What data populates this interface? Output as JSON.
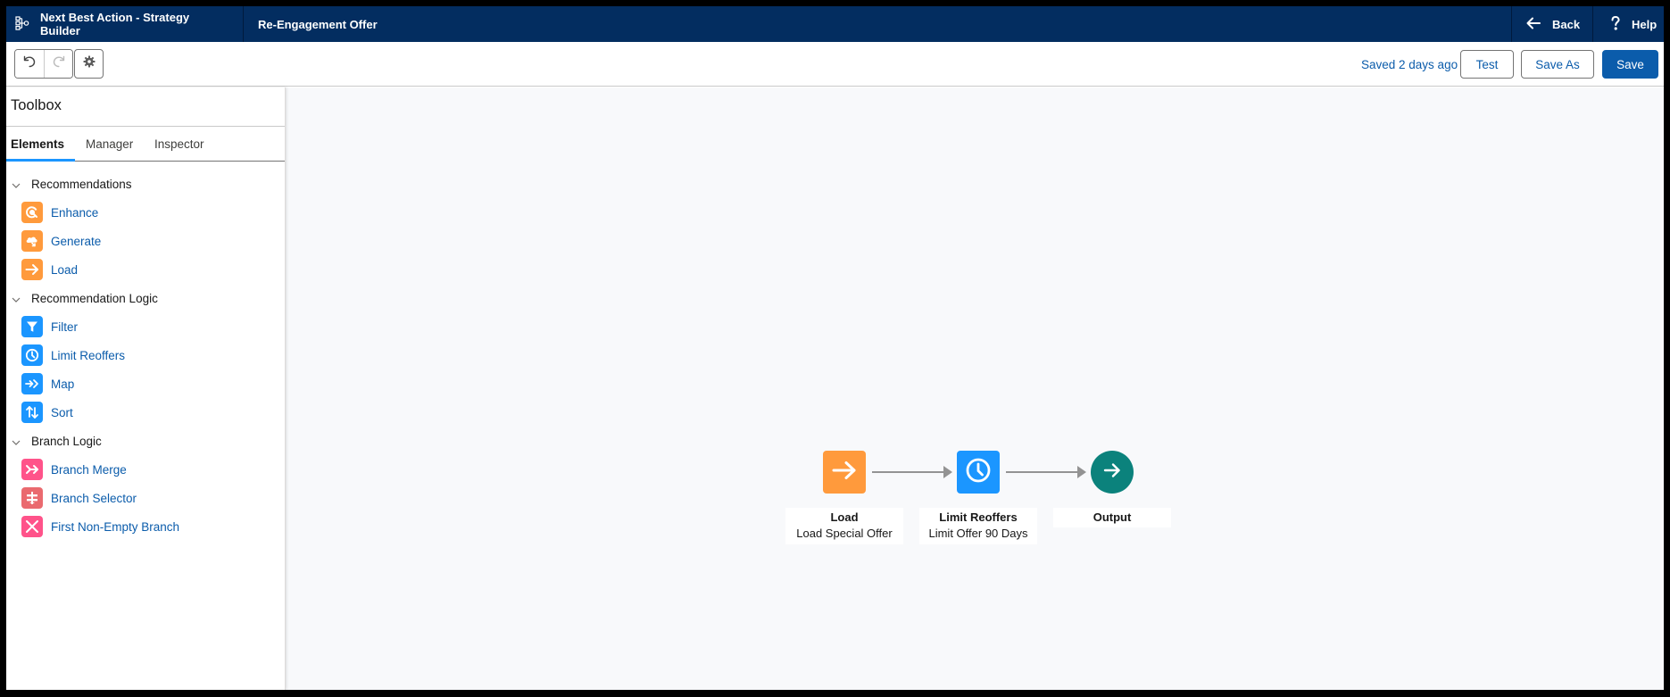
{
  "header": {
    "app_icon": "strategy-hierarchy-icon",
    "app_title": "Next Best Action - Strategy Builder",
    "record_title": "Re-Engagement Offer",
    "back_label": "Back",
    "back_icon": "arrow-left-icon",
    "help_label": "Help",
    "help_icon": "question-icon"
  },
  "toolbar": {
    "undo_icon": "undo-icon",
    "redo_icon": "redo-icon",
    "settings_icon": "gear-icon",
    "saved_status": "Saved 2 days ago",
    "test_label": "Test",
    "save_as_label": "Save As",
    "save_label": "Save"
  },
  "sidebar": {
    "title": "Toolbox",
    "tabs": [
      {
        "label": "Elements",
        "active": true
      },
      {
        "label": "Manager",
        "active": false
      },
      {
        "label": "Inspector",
        "active": false
      }
    ],
    "sections": [
      {
        "label": "Recommendations",
        "expanded": true,
        "items": [
          {
            "label": "Enhance",
            "icon": "enhance-icon",
            "color": "#FF9A3C"
          },
          {
            "label": "Generate",
            "icon": "generate-cloud-icon",
            "color": "#FF9A3C"
          },
          {
            "label": "Load",
            "icon": "arrow-right-icon",
            "color": "#FF9A3C"
          }
        ]
      },
      {
        "label": "Recommendation Logic",
        "expanded": true,
        "items": [
          {
            "label": "Filter",
            "icon": "filter-icon",
            "color": "#1B96FF"
          },
          {
            "label": "Limit Reoffers",
            "icon": "clock-icon",
            "color": "#1B96FF"
          },
          {
            "label": "Map",
            "icon": "map-arrows-icon",
            "color": "#1B96FF"
          },
          {
            "label": "Sort",
            "icon": "sort-icon",
            "color": "#1B96FF"
          }
        ]
      },
      {
        "label": "Branch Logic",
        "expanded": true,
        "items": [
          {
            "label": "Branch Merge",
            "icon": "branch-merge-icon",
            "color": "#FF538A"
          },
          {
            "label": "Branch Selector",
            "icon": "branch-selector-icon",
            "color": "#EA6A6F"
          },
          {
            "label": "First Non-Empty Branch",
            "icon": "close-x-icon",
            "color": "#FF538A"
          }
        ]
      }
    ]
  },
  "canvas": {
    "nodes": [
      {
        "type": "Load",
        "title": "Load",
        "subtitle": "Load Special Offer",
        "icon": "arrow-right-icon",
        "color": "#FF9A3C"
      },
      {
        "type": "Limit Reoffers",
        "title": "Limit Reoffers",
        "subtitle": "Limit Offer 90 Days",
        "icon": "clock-icon",
        "color": "#1B96FF"
      },
      {
        "type": "Output",
        "title": "Output",
        "icon": "arrow-right-icon",
        "color": "#0B827C"
      }
    ],
    "connections": [
      {
        "from": "Load",
        "to": "Limit Reoffers"
      },
      {
        "from": "Limit Reoffers",
        "to": "Output"
      }
    ]
  },
  "colors": {
    "header_bg": "#032D60",
    "brand_blue": "#0B5CAB",
    "tab_accent": "#1B96FF",
    "canvas_bg": "#F8F9FB"
  }
}
